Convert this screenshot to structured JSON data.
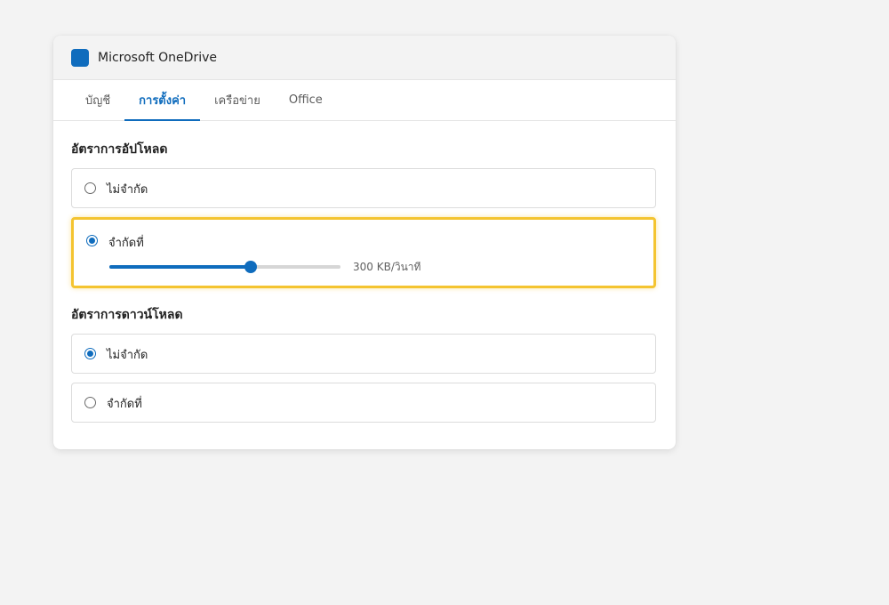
{
  "app": {
    "title": "Microsoft OneDrive",
    "icon": "onedrive-app-icon",
    "accent_color": "#0f6cbd"
  },
  "tabs": [
    {
      "label": "บัญชี",
      "active": false
    },
    {
      "label": "การตั้งค่า",
      "active": true
    },
    {
      "label": "เครือข่าย",
      "active": false
    },
    {
      "label": "Office",
      "active": false
    }
  ],
  "upload": {
    "title": "อัตราการอัปโหลด",
    "options": [
      {
        "label": "ไม่จำกัด",
        "selected": false
      },
      {
        "label": "จำกัดที่",
        "selected": true
      }
    ],
    "slider": {
      "fraction": 0.61,
      "value_label": "300 KB/วินาที"
    },
    "focus_color": "#f4c430"
  },
  "download": {
    "title": "อัตราการดาวน์โหลด",
    "options": [
      {
        "label": "ไม่จำกัด",
        "selected": true
      },
      {
        "label": "จำกัดที่",
        "selected": false
      }
    ]
  }
}
